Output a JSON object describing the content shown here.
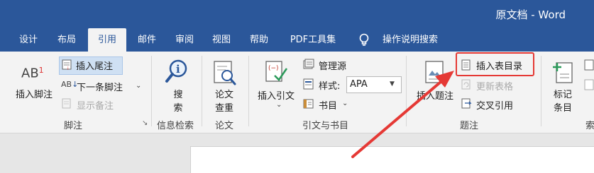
{
  "window": {
    "title": "原文档 - Word"
  },
  "tabs": [
    {
      "label": "设计",
      "active": false
    },
    {
      "label": "布局",
      "active": false
    },
    {
      "label": "引用",
      "active": true
    },
    {
      "label": "邮件",
      "active": false
    },
    {
      "label": "审阅",
      "active": false
    },
    {
      "label": "视图",
      "active": false
    },
    {
      "label": "帮助",
      "active": false
    },
    {
      "label": "PDF工具集",
      "active": false
    },
    {
      "label": "操作说明搜索",
      "active": false
    }
  ],
  "footnotes": {
    "insert_footnote_icon_text": "AB",
    "insert_footnote_icon_sup": "1",
    "insert_footnote": "插入脚注",
    "insert_endnote": "插入尾注",
    "next_footnote": "下一条脚注",
    "next_footnote_icon_text": "AB",
    "show_notes": "显示备注",
    "group_label": "脚注"
  },
  "research": {
    "search": "搜\n索",
    "group_label": "信息检索"
  },
  "paper": {
    "check": "论文\n查重",
    "group_label": "论文"
  },
  "citations": {
    "insert_citation": "插入引文",
    "manage_sources": "管理源",
    "style_label": "样式:",
    "style_value": "APA",
    "bibliography": "书目",
    "group_label": "引文与书目"
  },
  "captions": {
    "insert_caption": "插入题注",
    "insert_table_of_figures": "插入表目录",
    "update_table": "更新表格",
    "cross_reference": "交叉引用",
    "group_label": "题注"
  },
  "index": {
    "mark_entry": "标记\n条目",
    "group_label": "索"
  },
  "colors": {
    "accent": "#2b579a",
    "highlight": "#e53935"
  }
}
